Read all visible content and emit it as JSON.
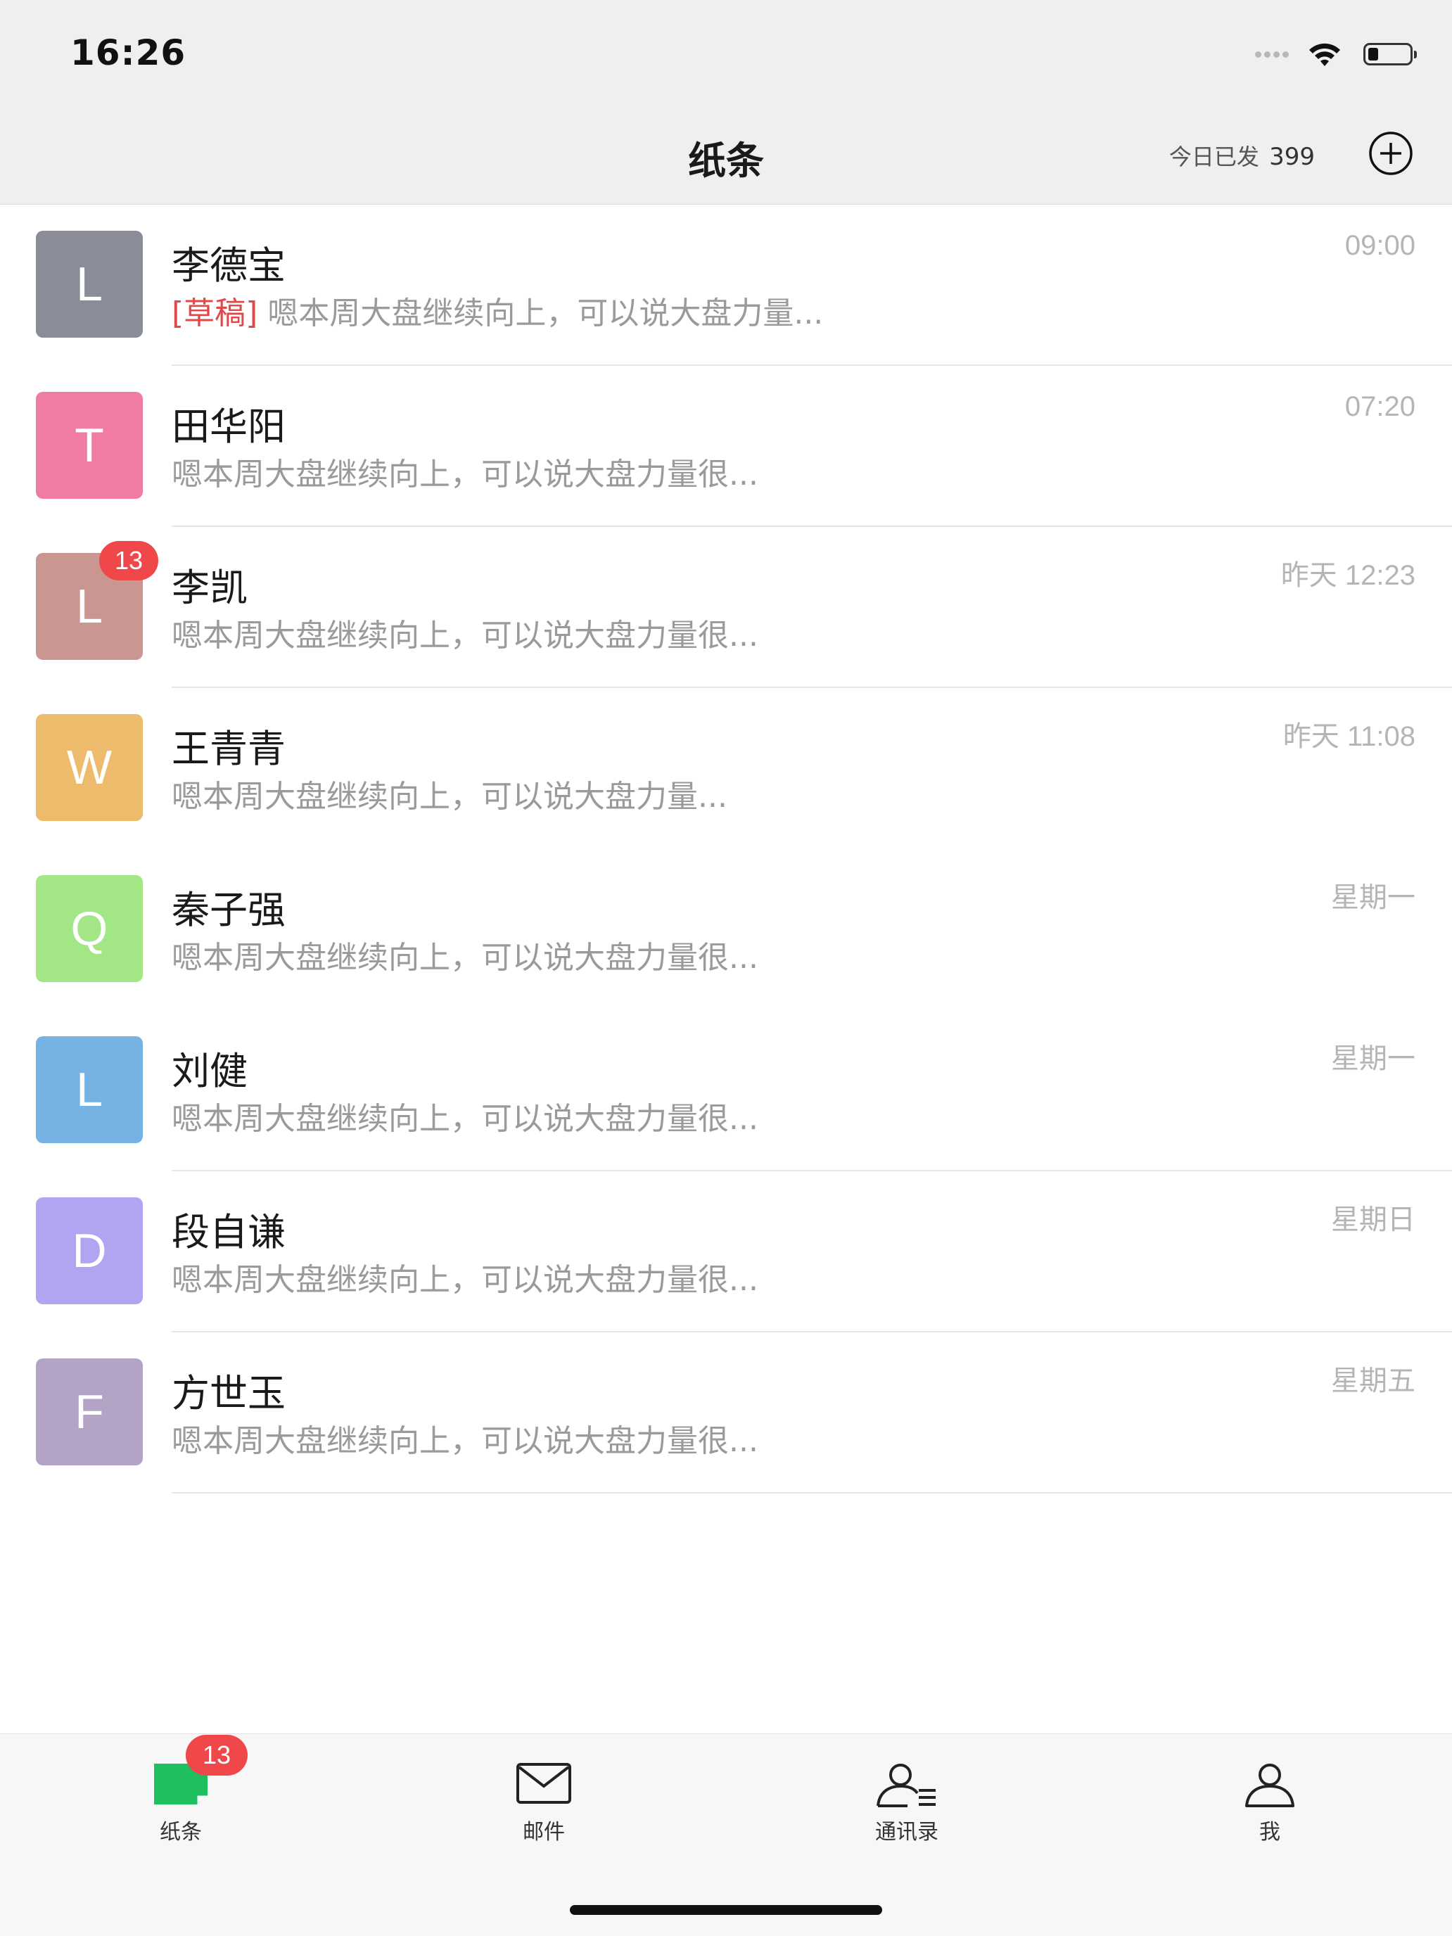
{
  "status_bar": {
    "time": "16:26",
    "battery_level": 0.25
  },
  "nav": {
    "title": "纸条",
    "sent_today_label": "今日已发",
    "sent_today_count": "399",
    "add_icon": "plus-circle-icon"
  },
  "conversations": [
    {
      "initial": "L",
      "color": "#8a8d97",
      "name": "李德宝",
      "draft_tag": "[草稿]",
      "preview": " 嗯本周大盘继续向上，可以说大盘力量...",
      "time": "09:00",
      "badge": ""
    },
    {
      "initial": "T",
      "color": "#f07ba4",
      "name": "田华阳",
      "draft_tag": "",
      "preview": "嗯本周大盘继续向上，可以说大盘力量很...",
      "time": "07:20",
      "badge": ""
    },
    {
      "initial": "L",
      "color": "#c99691",
      "name": "李凯",
      "draft_tag": "",
      "preview": "嗯本周大盘继续向上，可以说大盘力量很...",
      "time": "昨天 12:23",
      "badge": "13"
    },
    {
      "initial": "W",
      "color": "#edbb6c",
      "name": "王青青",
      "draft_tag": "",
      "preview": "嗯本周大盘继续向上，可以说大盘力量...",
      "time": "昨天 11:08",
      "badge": ""
    },
    {
      "initial": "Q",
      "color": "#a3e686",
      "name": "秦子强",
      "draft_tag": "",
      "preview": "嗯本周大盘继续向上，可以说大盘力量很...",
      "time": "星期一",
      "badge": ""
    },
    {
      "initial": "L",
      "color": "#77b2e4",
      "name": "刘健",
      "draft_tag": "",
      "preview": "嗯本周大盘继续向上，可以说大盘力量很...",
      "time": "星期一",
      "badge": ""
    },
    {
      "initial": "D",
      "color": "#b2a4f0",
      "name": "段自谦",
      "draft_tag": "",
      "preview": "嗯本周大盘继续向上，可以说大盘力量很...",
      "time": "星期日",
      "badge": ""
    },
    {
      "initial": "F",
      "color": "#b3a4c6",
      "name": "方世玉",
      "draft_tag": "",
      "preview": "嗯本周大盘继续向上，可以说大盘力量很...",
      "time": "星期五",
      "badge": ""
    }
  ],
  "tab_bar": {
    "tabs": [
      {
        "label": "纸条",
        "icon": "note-icon",
        "active": true
      },
      {
        "label": "邮件",
        "icon": "mail-icon",
        "active": false
      },
      {
        "label": "通讯录",
        "icon": "contacts-icon",
        "active": false
      },
      {
        "label": "我",
        "icon": "user-icon",
        "active": false
      }
    ],
    "badge": "13",
    "accent": "#1dbf5f"
  }
}
